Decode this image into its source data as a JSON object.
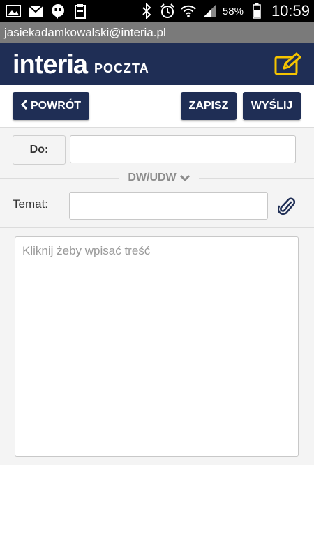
{
  "status_bar": {
    "battery_percent": "58%",
    "time": "10:59",
    "left_icons": [
      "gallery-icon",
      "gmail-icon",
      "hangouts-icon",
      "clipboard-icon"
    ],
    "right_icons": [
      "bluetooth-icon",
      "alarm-icon",
      "wifi-icon",
      "signal-icon",
      "battery-icon"
    ]
  },
  "account": {
    "email": "jasiekadamkowalski@interia.pl"
  },
  "header": {
    "logo_text": "interia",
    "logo_sub": "POCZTA",
    "compose_icon": "compose-icon"
  },
  "toolbar": {
    "back_label": "POWRÓT",
    "save_label": "ZAPISZ",
    "send_label": "WYŚLIJ"
  },
  "form": {
    "to_label": "Do:",
    "to_value": "",
    "cc_toggle_label": "DW/UDW",
    "subject_label": "Temat:",
    "subject_value": "",
    "body_placeholder": "Kliknij żeby wpisać treść"
  },
  "colors": {
    "brand_navy": "#1f2e55",
    "accent_yellow": "#f5c400",
    "account_bar": "#7a7a7a"
  }
}
